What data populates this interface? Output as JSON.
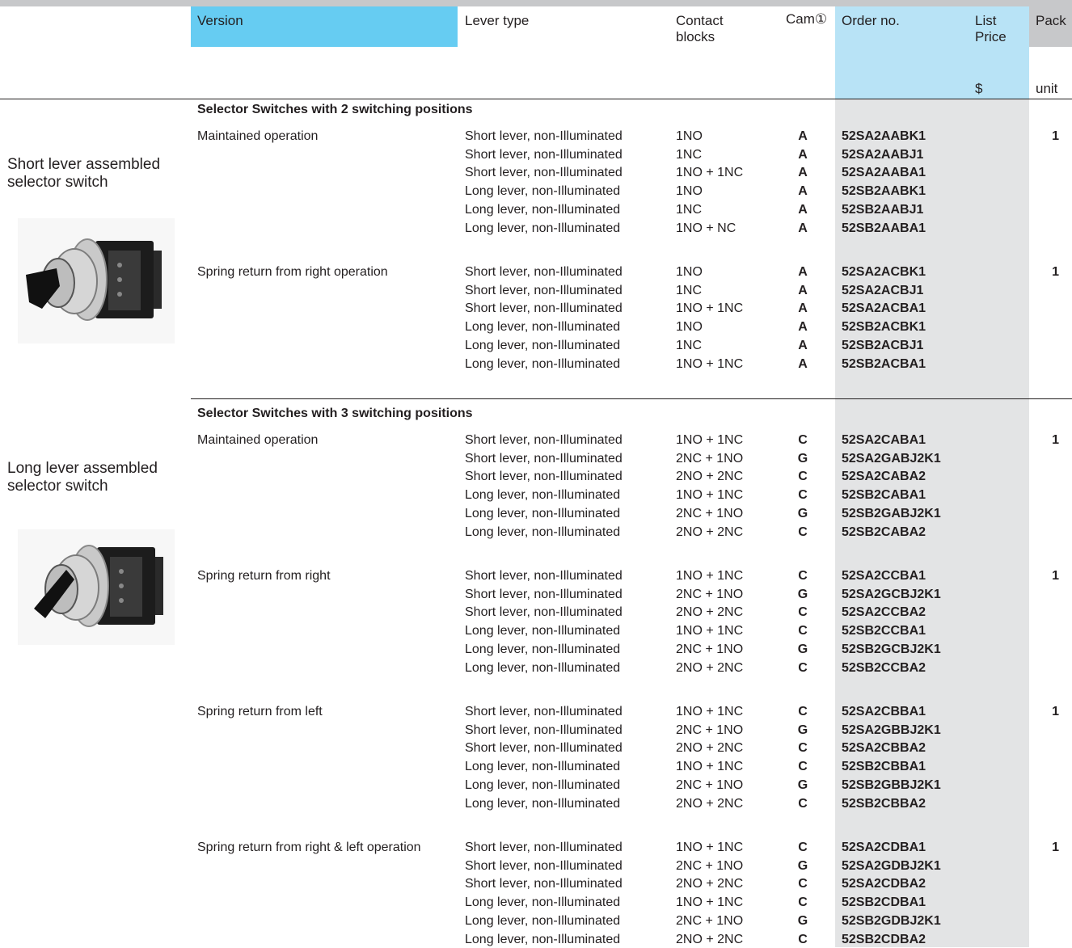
{
  "header": {
    "version": "Version",
    "lever_type": "Lever type",
    "contact_blocks_1": "Contact",
    "contact_blocks_2": "blocks",
    "cam": "Cam①",
    "order_no": "Order no.",
    "list_price_1": "List",
    "list_price_2": "Price",
    "currency": "$",
    "pack": "Pack",
    "unit": "unit"
  },
  "side": {
    "short_title_1": "Short lever assembled",
    "short_title_2": "selector switch",
    "long_title_1": "Long lever assembled",
    "long_title_2": "selector switch"
  },
  "sections": [
    {
      "title": "Selector Switches with 2 switching positions",
      "groups": [
        {
          "version": "Maintained operation",
          "pack": "1",
          "rows": [
            {
              "lever": "Short lever, non-Illuminated",
              "contacts": "1NO",
              "cam": "A",
              "order": "52SA2AABK1"
            },
            {
              "lever": "Short lever, non-Illuminated",
              "contacts": "1NC",
              "cam": "A",
              "order": "52SA2AABJ1"
            },
            {
              "lever": "Short lever, non-Illuminated",
              "contacts": "1NO + 1NC",
              "cam": "A",
              "order": "52SA2AABA1"
            },
            {
              "lever": "Long  lever, non-Illuminated",
              "contacts": "1NO",
              "cam": "A",
              "order": "52SB2AABK1"
            },
            {
              "lever": "Long  lever, non-Illuminated",
              "contacts": "1NC",
              "cam": "A",
              "order": "52SB2AABJ1"
            },
            {
              "lever": "Long  lever, non-Illuminated",
              "contacts": "1NO + NC",
              "cam": "A",
              "order": "52SB2AABA1"
            }
          ]
        },
        {
          "version": "Spring return from right operation",
          "pack": "1",
          "rows": [
            {
              "lever": "Short lever, non-Illuminated",
              "contacts": "1NO",
              "cam": "A",
              "order": "52SA2ACBK1"
            },
            {
              "lever": "Short lever, non-Illuminated",
              "contacts": "1NC",
              "cam": "A",
              "order": "52SA2ACBJ1"
            },
            {
              "lever": "Short lever, non-Illuminated",
              "contacts": "1NO + 1NC",
              "cam": "A",
              "order": "52SA2ACBA1"
            },
            {
              "lever": "Long  lever, non-Illuminated",
              "contacts": "1NO",
              "cam": "A",
              "order": "52SB2ACBK1"
            },
            {
              "lever": "Long  lever, non-Illuminated",
              "contacts": "1NC",
              "cam": "A",
              "order": "52SB2ACBJ1"
            },
            {
              "lever": "Long  lever, non-Illuminated",
              "contacts": "1NO + 1NC",
              "cam": "A",
              "order": "52SB2ACBA1"
            }
          ]
        }
      ]
    },
    {
      "title": "Selector Switches with 3 switching positions",
      "groups": [
        {
          "version": "Maintained operation",
          "pack": "1",
          "rows": [
            {
              "lever": "Short lever, non-Illuminated",
              "contacts": "1NO + 1NC",
              "cam": "C",
              "order": "52SA2CABA1"
            },
            {
              "lever": "Short lever, non-Illuminated",
              "contacts": "2NC + 1NO",
              "cam": "G",
              "order": "52SA2GABJ2K1"
            },
            {
              "lever": "Short lever, non-Illuminated",
              "contacts": "2NO + 2NC",
              "cam": "C",
              "order": "52SA2CABA2"
            },
            {
              "lever": "Long  lever, non-Illuminated",
              "contacts": "1NO + 1NC",
              "cam": "C",
              "order": "52SB2CABA1"
            },
            {
              "lever": "Long  lever, non-Illuminated",
              "contacts": "2NC + 1NO",
              "cam": "G",
              "order": "52SB2GABJ2K1"
            },
            {
              "lever": "Long  lever, non-Illuminated",
              "contacts": "2NO + 2NC",
              "cam": "C",
              "order": "52SB2CABA2"
            }
          ]
        },
        {
          "version": "Spring return from right",
          "pack": "1",
          "rows": [
            {
              "lever": "Short lever, non-Illuminated",
              "contacts": "1NO + 1NC",
              "cam": "C",
              "order": "52SA2CCBA1"
            },
            {
              "lever": "Short lever, non-Illuminated",
              "contacts": "2NC + 1NO",
              "cam": "G",
              "order": "52SA2GCBJ2K1"
            },
            {
              "lever": "Short lever, non-Illuminated",
              "contacts": "2NO + 2NC",
              "cam": "C",
              "order": "52SA2CCBA2"
            },
            {
              "lever": "Long  lever, non-Illuminated",
              "contacts": "1NO + 1NC",
              "cam": "C",
              "order": "52SB2CCBA1"
            },
            {
              "lever": "Long  lever, non-Illuminated",
              "contacts": "2NC + 1NO",
              "cam": "G",
              "order": "52SB2GCBJ2K1"
            },
            {
              "lever": "Long  lever, non-Illuminated",
              "contacts": "2NO + 2NC",
              "cam": "C",
              "order": "52SB2CCBA2"
            }
          ]
        },
        {
          "version": "Spring return from left",
          "pack": "1",
          "rows": [
            {
              "lever": "Short lever, non-Illuminated",
              "contacts": "1NO + 1NC",
              "cam": "C",
              "order": "52SA2CBBA1"
            },
            {
              "lever": "Short lever, non-Illuminated",
              "contacts": "2NC + 1NO",
              "cam": "G",
              "order": "52SA2GBBJ2K1"
            },
            {
              "lever": "Short lever, non-Illuminated",
              "contacts": "2NO + 2NC",
              "cam": "C",
              "order": "52SA2CBBA2"
            },
            {
              "lever": "Long  lever, non-Illuminated",
              "contacts": "1NO + 1NC",
              "cam": "C",
              "order": "52SB2CBBA1"
            },
            {
              "lever": "Long  lever, non-Illuminated",
              "contacts": "2NC + 1NO",
              "cam": "G",
              "order": "52SB2GBBJ2K1"
            },
            {
              "lever": "Long  lever, non-Illuminated",
              "contacts": "2NO + 2NC",
              "cam": "C",
              "order": "52SB2CBBA2"
            }
          ]
        },
        {
          "version": "Spring return from right & left operation",
          "pack": "1",
          "rows": [
            {
              "lever": "Short lever, non-Illuminated",
              "contacts": "1NO + 1NC",
              "cam": "C",
              "order": "52SA2CDBA1"
            },
            {
              "lever": "Short lever, non-Illuminated",
              "contacts": "2NC + 1NO",
              "cam": "G",
              "order": "52SA2GDBJ2K1"
            },
            {
              "lever": "Short lever, non-Illuminated",
              "contacts": "2NO + 2NC",
              "cam": "C",
              "order": "52SA2CDBA2"
            },
            {
              "lever": "Long  lever, non-Illuminated",
              "contacts": "1NO + 1NC",
              "cam": "C",
              "order": "52SB2CDBA1"
            },
            {
              "lever": "Long  lever, non-Illuminated",
              "contacts": "2NC + 1NO",
              "cam": "G",
              "order": "52SB2GDBJ2K1"
            },
            {
              "lever": "Long  lever, non-Illuminated",
              "contacts": "2NO + 2NC",
              "cam": "C",
              "order": "52SB2CDBA2"
            }
          ]
        }
      ]
    }
  ]
}
